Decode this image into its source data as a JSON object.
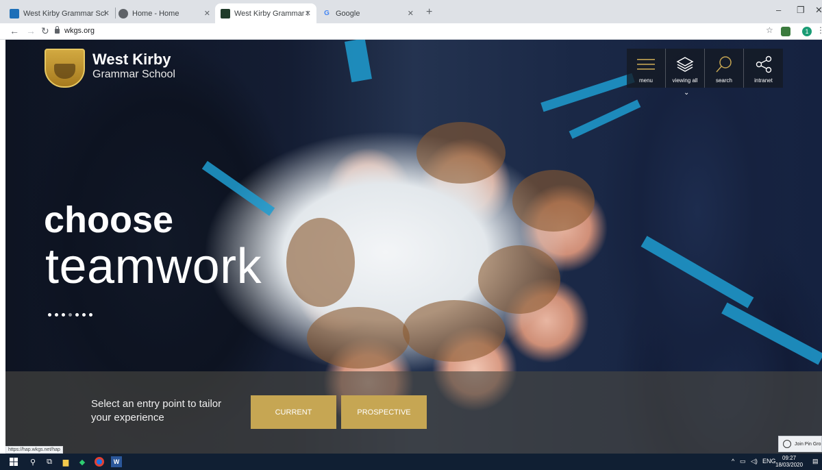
{
  "browser": {
    "tabs": [
      {
        "title": "West Kirby Grammar School - Ho",
        "favicon_color": "#1d6fb8",
        "active": false
      },
      {
        "title": "Home - Home",
        "favicon_color": "#5f6368",
        "active": false
      },
      {
        "title": "West Kirby Grammar School | We",
        "favicon_color": "#1f3b2a",
        "active": true
      },
      {
        "title": "Google",
        "favicon_color": "#4285f4",
        "favicon_text": "G",
        "active": false
      }
    ],
    "url": "wkgs.org",
    "profile_initial": "1"
  },
  "site": {
    "logo_line1": "West Kirby",
    "logo_line2": "Grammar School",
    "nav": [
      {
        "label": "menu",
        "icon": "hamburger-icon"
      },
      {
        "label": "viewing all",
        "icon": "layers-icon"
      },
      {
        "label": "search",
        "icon": "search-icon"
      },
      {
        "label": "intranet",
        "icon": "share-icon"
      }
    ],
    "headline_line1": "choose",
    "headline_line2": "teamwork",
    "slide_count": 7,
    "slide_active": 0,
    "entry_prompt": "Select an entry point to tailor your experience",
    "buttons": {
      "current": "CURRENT",
      "prospective": "PROSPECTIVE"
    },
    "accent_gold": "#c6a653"
  },
  "status_link": "https://hap.wkgs.net/hap",
  "chat_popup": "Join Pin Gro",
  "taskbar": {
    "lang": "ENG",
    "time": "09:27",
    "date": "18/03/2020"
  }
}
